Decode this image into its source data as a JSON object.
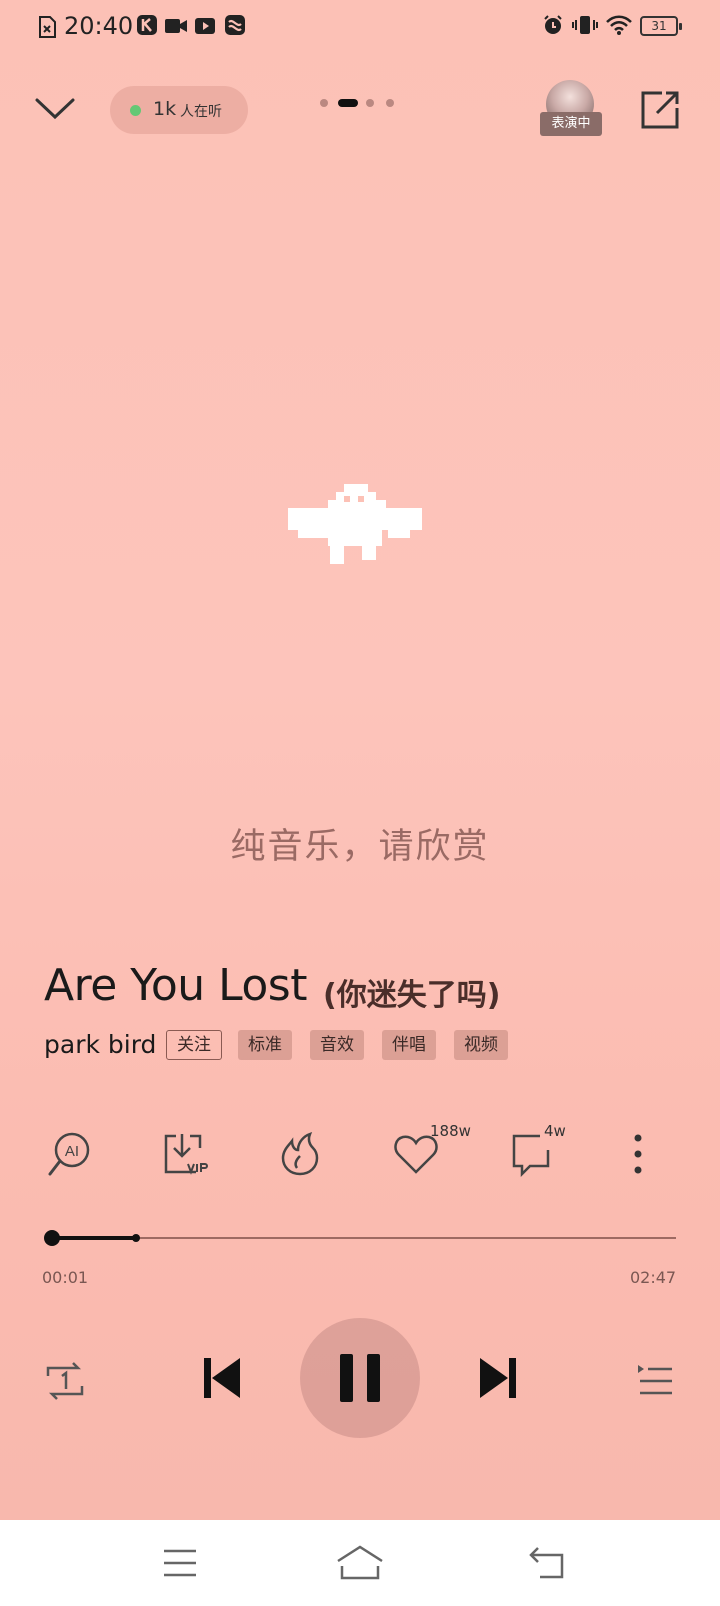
{
  "status_bar": {
    "time": "20:40",
    "battery": "31"
  },
  "header": {
    "listeners_count": "1k",
    "listeners_label": "人在听",
    "performing_label": "表演中",
    "page_indicator": {
      "total": 4,
      "active": 2
    }
  },
  "lyrics": {
    "line": "纯音乐，请欣赏"
  },
  "song": {
    "title": "Are You Lost",
    "subtitle": "(你迷失了吗)",
    "artist": "park bird",
    "tags": [
      "关注",
      "标准",
      "音效",
      "伴唱",
      "视频"
    ]
  },
  "actions": {
    "ai_label": "AI",
    "like_count": "188w",
    "comment_count": "4w"
  },
  "progress": {
    "current": "00:01",
    "total": "02:47",
    "played_fraction": 0.006,
    "buffered_fraction": 0.14
  },
  "colors": {
    "background": "#fcc1b6",
    "listeners_dot": "#64c875",
    "lyric_text": "#9a6a64"
  }
}
